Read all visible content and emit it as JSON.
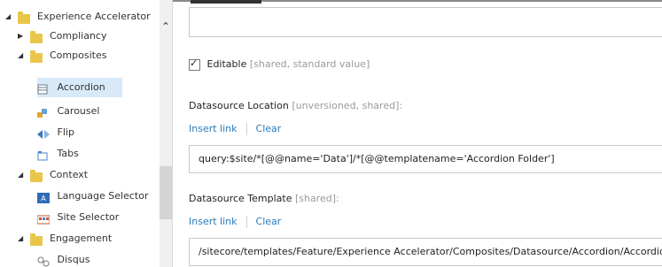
{
  "tree": {
    "items": [
      {
        "label": "Experience Accelerator",
        "icon": "folder-icon",
        "expanded": true
      },
      {
        "label": "Compliancy",
        "icon": "folder-icon",
        "expanded": false
      },
      {
        "label": "Composites",
        "icon": "folder-icon",
        "expanded": true
      },
      {
        "label": "Accordion",
        "icon": "accordion-icon",
        "selected": true
      },
      {
        "label": "Carousel",
        "icon": "carousel-icon"
      },
      {
        "label": "Flip",
        "icon": "flip-icon"
      },
      {
        "label": "Tabs",
        "icon": "tabs-icon"
      },
      {
        "label": "Context",
        "icon": "folder-icon",
        "expanded": true
      },
      {
        "label": "Language Selector",
        "icon": "language-selector-icon"
      },
      {
        "label": "Site Selector",
        "icon": "site-selector-icon"
      },
      {
        "label": "Engagement",
        "icon": "folder-icon",
        "expanded": true
      },
      {
        "label": "Disqus",
        "icon": "disqus-icon"
      }
    ]
  },
  "editor": {
    "editable_label": "Editable",
    "editable_meta": "[shared, standard value]",
    "editable_checked": true,
    "datasource_location_label": "Datasource Location",
    "datasource_location_meta": "[unversioned, shared]:",
    "insert_link_1": "Insert link",
    "clear_1": "Clear",
    "datasource_location_value": "query:$site/*[@@name='Data']/*[@@templatename='Accordion Folder']",
    "datasource_template_label": "Datasource Template",
    "datasource_template_meta": "[shared]:",
    "insert_link_2": "Insert link",
    "clear_2": "Clear",
    "datasource_template_value": "/sitecore/templates/Feature/Experience Accelerator/Composites/Datasource/Accordion/Accordion"
  },
  "colors": {
    "link": "#2a7ab8",
    "selection": "#d8e9f8",
    "folder": "#e9c64a"
  }
}
